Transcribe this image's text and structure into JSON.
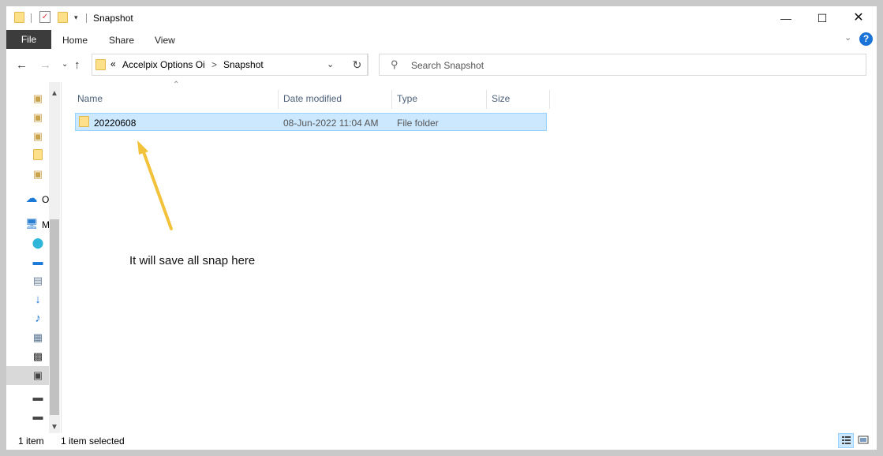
{
  "window": {
    "title": "Snapshot"
  },
  "ribbon": {
    "file": "File",
    "tabs": [
      "Home",
      "Share",
      "View"
    ],
    "help": "?"
  },
  "nav": {
    "overflow": "«",
    "crumbs": [
      "Accelpix Options Oi",
      "Snapshot"
    ],
    "separator": ">",
    "search_placeholder": "Search Snapshot"
  },
  "sidebar": {
    "letters": [
      "O",
      "M"
    ]
  },
  "columns": [
    "Name",
    "Date modified",
    "Type",
    "Size"
  ],
  "rows": [
    {
      "name": "20220608",
      "date": "08-Jun-2022 11:04 AM",
      "type": "File folder",
      "size": ""
    }
  ],
  "annotation": {
    "text": "It will save all snap here",
    "color": "#f2c23b"
  },
  "status": {
    "count": "1 item",
    "selected": "1 item selected"
  }
}
